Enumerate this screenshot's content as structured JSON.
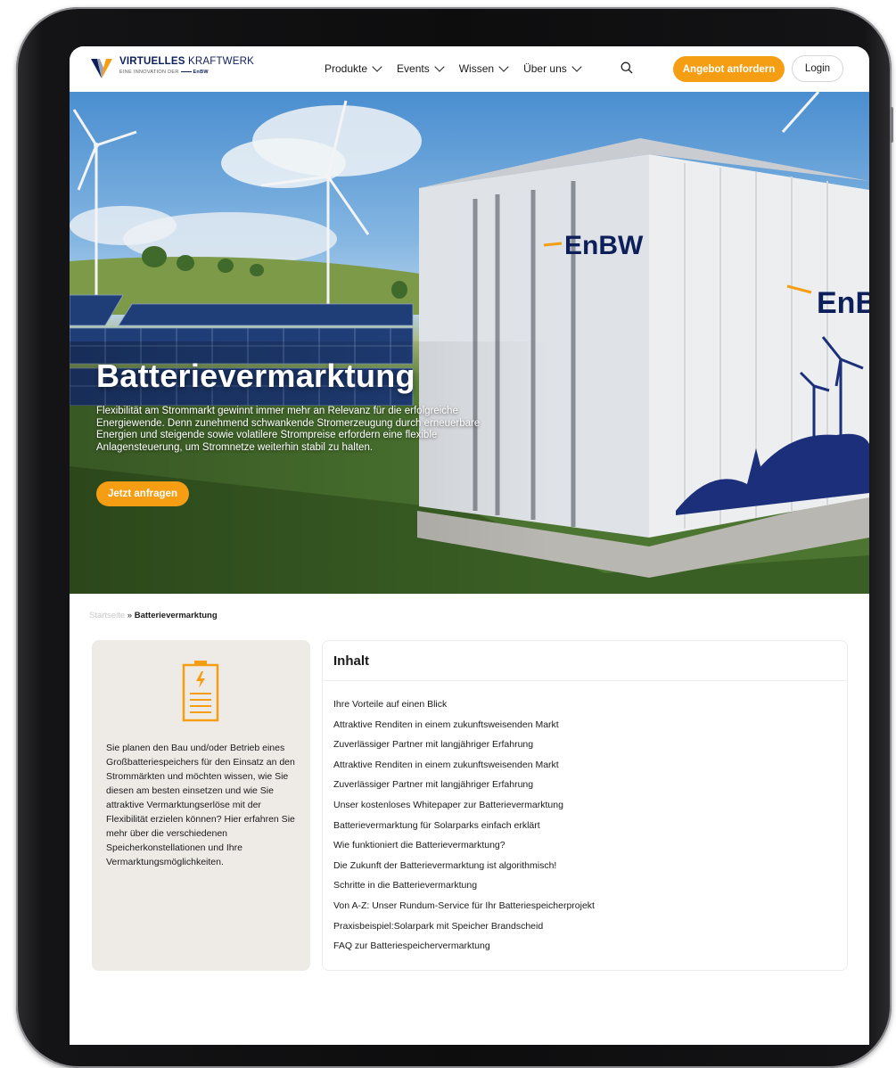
{
  "header": {
    "logo_title_bold": "VIRTUELLES",
    "logo_title_light": "KRAFTWERK",
    "logo_subtitle": "EINE INNOVATION DER",
    "logo_brand": "EnBW",
    "nav": [
      {
        "label": "Produkte"
      },
      {
        "label": "Events"
      },
      {
        "label": "Wissen"
      },
      {
        "label": "Über uns"
      }
    ],
    "cta_label": "Angebot anfordern",
    "login_label": "Login"
  },
  "hero": {
    "title": "Batterievermarktung",
    "text": "Flexibilität am Strommarkt gewinnt immer mehr an Relevanz für die erfolgreiche Energiewende. Denn zunehmend schwankende Stromerzeugung durch erneuerbare Energien und steigende sowie volatilere Strompreise erfordern eine flexible Anlagensteuerung, um Stromnetze weiterhin stabil zu halten.",
    "button_label": "Jetzt anfragen",
    "container_brand": "EnBW"
  },
  "breadcrumb": {
    "home": "Startseite",
    "separator": "»",
    "current": "Batterievermarktung"
  },
  "info": {
    "text": "Sie planen den Bau und/oder Betrieb eines Großbatteriespeichers für den Einsatz an den Strommärkten und möchten wissen, wie Sie diesen am besten einsetzen und wie Sie attraktive Vermarktungserlöse mit der Flexibilität erzielen können? Hier erfahren Sie mehr über die verschiedenen Speicherkonstellationen und Ihre Vermarktungsmöglichkeiten.",
    "icon": "battery-icon"
  },
  "toc": {
    "title": "Inhalt",
    "items": [
      "Ihre Vorteile auf einen Blick",
      "Attraktive Renditen in einem zukunftsweisenden Markt",
      "Zuverlässiger Partner mit langjähriger Erfahrung",
      "Attraktive Renditen in einem zukunftsweisenden Markt",
      "Zuverlässiger Partner mit langjähriger Erfahrung",
      "Unser kostenloses Whitepaper zur Batterievermarktung",
      "Batterievermarktung für Solarparks einfach erklärt",
      "Wie funktioniert die Batterievermarktung?",
      "Die Zukunft der Batterievermarktung ist algorithmisch!",
      "Schritte in die Batterievermarktung",
      "Von A-Z: Unser Rundum-Service für Ihr Batteriespeicherprojekt",
      "Praxisbeispiel:Solarpark mit Speicher Brandscheid",
      "FAQ zur Batteriespeichervermarktung"
    ]
  },
  "colors": {
    "accent": "#f59d13",
    "brand_navy": "#0d1f5a",
    "info_bg": "#eeebe7"
  }
}
